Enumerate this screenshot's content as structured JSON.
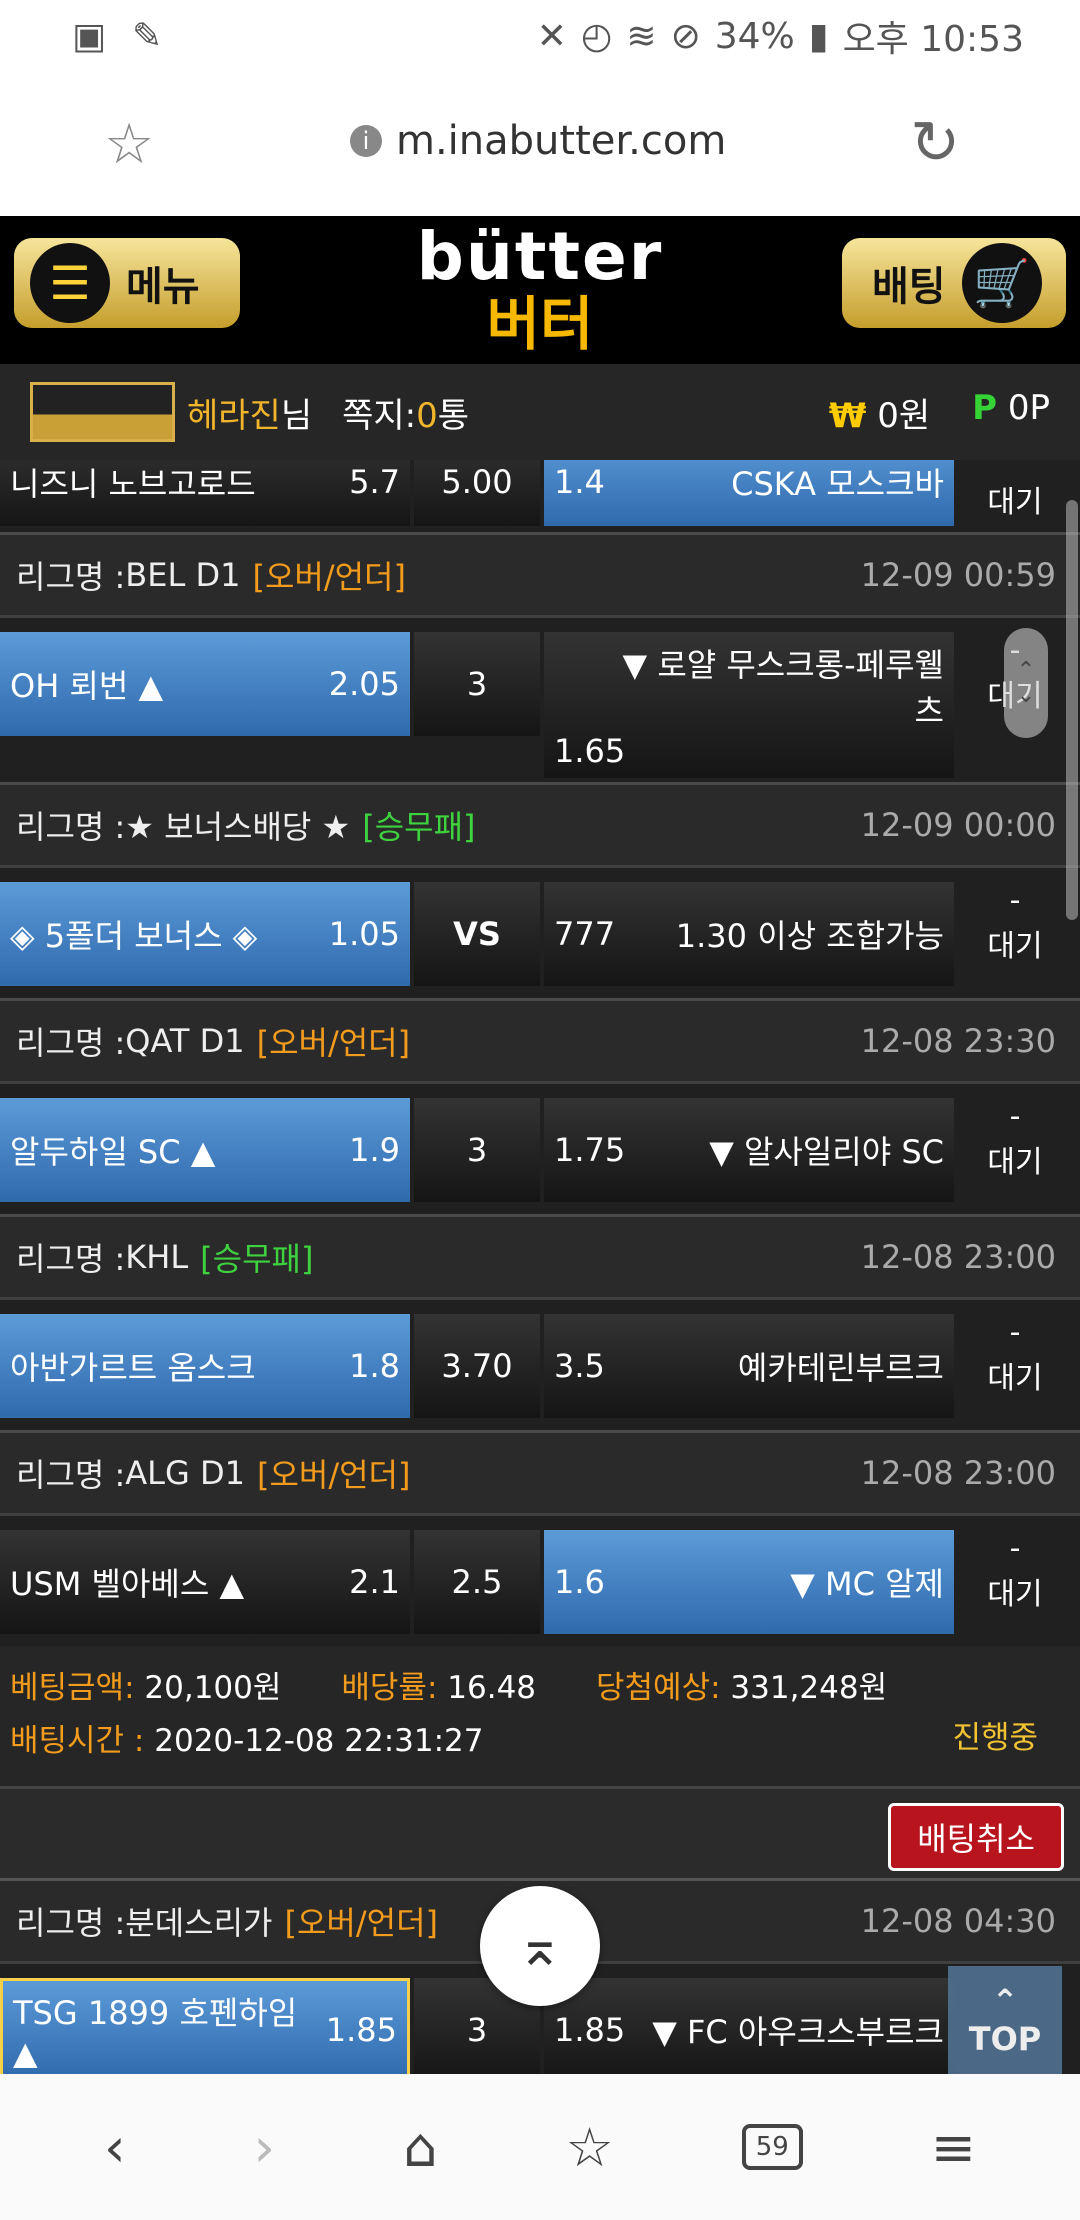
{
  "statusbar": {
    "battery": "34%",
    "time": "오후 10:53"
  },
  "browser": {
    "url": "m.inabutter.com"
  },
  "site": {
    "menu_label": "메뉴",
    "bet_label": "배팅",
    "logo_en": "bütter",
    "logo_ko": "버터"
  },
  "user": {
    "name": "헤라진",
    "name_suffix": "님",
    "msg_label": "쪽지:",
    "msg_count": "0",
    "msg_unit": "통",
    "won_symbol": "₩",
    "won_value": "0원",
    "point_symbol": "P",
    "point_value": "0P"
  },
  "league_prefix": "리그명 : ",
  "top_row": {
    "home": "니즈니 노브고로드",
    "home_odd": "5.7",
    "mid": "5.00",
    "away_odd": "1.4",
    "away": "CSKA 모스크바",
    "status_dash": "-",
    "status": "대기"
  },
  "leagues": [
    {
      "name": "BEL D1",
      "tag": "[오버/언더]",
      "time": "12-09 00:59",
      "home": "OH 뢰번 ▲",
      "home_odd": "2.05",
      "mid": "3",
      "away_odd": "1.65",
      "away": "▼ 로얄 무스크롱-페루웰츠",
      "status": "대기"
    },
    {
      "name": "★ 보너스배당 ★",
      "tag": "[승무패]",
      "time": "12-09 00:00",
      "home": "◈ 5폴더 보너스 ◈",
      "home_odd": "1.05",
      "mid": "VS",
      "away_odd": "777",
      "away": "1.30 이상 조합가능",
      "status": "대기"
    },
    {
      "name": "QAT D1",
      "tag": "[오버/언더]",
      "time": "12-08 23:30",
      "home": "알두하일 SC ▲",
      "home_odd": "1.9",
      "mid": "3",
      "away_odd": "1.75",
      "away": "▼ 알사일리야 SC",
      "status": "대기"
    },
    {
      "name": "KHL",
      "tag": "[승무패]",
      "time": "12-08 23:00",
      "home": "아반가르트 옴스크",
      "home_odd": "1.8",
      "mid": "3.70",
      "away_odd": "3.5",
      "away": "예카테린부르크",
      "status": "대기"
    },
    {
      "name": "ALG D1",
      "tag": "[오버/언더]",
      "time": "12-08 23:00",
      "home": "USM 벨아베스 ▲",
      "home_odd": "2.1",
      "mid": "2.5",
      "away_odd": "1.6",
      "away": "▼ MC 알제",
      "status": "대기"
    }
  ],
  "bet": {
    "amount_label": "베팅금액:",
    "amount": "20,100원",
    "rate_label": "배당률:",
    "rate": "16.48",
    "expect_label": "당첨예상:",
    "expect": "331,248원",
    "time_label": "배팅시간 :",
    "time": "2020-12-08 22:31:27",
    "progress": "진행중",
    "cancel": "배팅취소"
  },
  "bottom_league": {
    "name": "분데스리가",
    "tag": "[오버/언더]",
    "time": "12-08 04:30",
    "home": "TSG 1899 호펜하임 ▲",
    "home_odd": "1.85",
    "mid": "3",
    "away_odd": "1.85",
    "away": "▼ FC 아우크스부르크"
  },
  "top_button": "TOP",
  "tab_count": "59"
}
